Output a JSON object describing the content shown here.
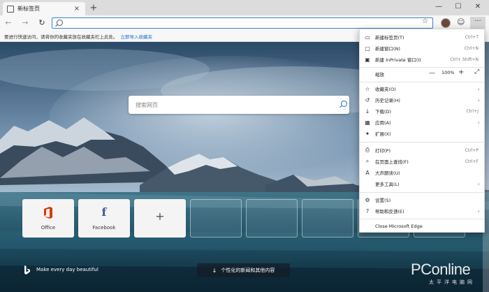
{
  "tab": {
    "title": "新标签页",
    "close": "×",
    "new_tab": "+"
  },
  "window": {
    "minimize": "—",
    "maximize": "☐",
    "close": "✕"
  },
  "toolbar": {
    "back": "←",
    "forward": "→",
    "refresh": "↻",
    "favorite": "☆",
    "emoji": "☺",
    "more": "···"
  },
  "address": {
    "value": "",
    "placeholder": ""
  },
  "favbar": {
    "message": "要进行快速访问，请将你的收藏夹放在收藏夹栏上此处。",
    "link": "立即导入收藏夹"
  },
  "search": {
    "placeholder": "搜索网页"
  },
  "tiles": [
    {
      "label": "Office",
      "icon": "office-icon"
    },
    {
      "label": "Facebook",
      "icon": "facebook-icon"
    },
    {
      "label": "",
      "icon": "plus-icon"
    }
  ],
  "footer": {
    "tagline": "Make every day beautiful",
    "news_button": "个性化的新闻和其他内容",
    "news_arrow": "↓"
  },
  "watermark": {
    "brand": "PConline",
    "sub": "太平洋电脑网"
  },
  "menu": {
    "items": [
      {
        "icon": "new-tab-icon",
        "glyph": "▭",
        "label": "新建标签页(T)",
        "shortcut": "Ctrl+T"
      },
      {
        "icon": "new-window-icon",
        "glyph": "▢",
        "label": "新建窗口(N)",
        "shortcut": "Ctrl+N"
      },
      {
        "icon": "inprivate-icon",
        "glyph": "▣",
        "label": "新建 InPrivate 窗口(I)",
        "shortcut": "Ctrl+  Shift+N"
      },
      {
        "icon": "favorites-icon",
        "glyph": "☆",
        "label": "收藏夹(O)",
        "shortcut": ""
      },
      {
        "icon": "history-icon",
        "glyph": "↺",
        "label": "历史记录(H)",
        "shortcut": ""
      },
      {
        "icon": "download-icon",
        "glyph": "↓",
        "label": "下载(D)",
        "shortcut": "Ctrl+J"
      },
      {
        "icon": "apps-icon",
        "glyph": "▦",
        "label": "应用(A)",
        "shortcut": ""
      },
      {
        "icon": "extensions-icon",
        "glyph": "✦",
        "label": "扩展(X)",
        "shortcut": ""
      },
      {
        "icon": "print-icon",
        "glyph": "⎙",
        "label": "打印(P)",
        "shortcut": "Ctrl+P"
      },
      {
        "icon": "find-icon",
        "glyph": "⌕",
        "label": "在页面上查找(F)",
        "shortcut": "Ctrl+F"
      },
      {
        "icon": "read-aloud-icon",
        "glyph": "A",
        "label": "大声朗读(U)",
        "shortcut": ""
      },
      {
        "icon": "more-tools-icon",
        "glyph": "",
        "label": "更多工具(L)",
        "shortcut": ""
      },
      {
        "icon": "settings-icon",
        "glyph": "⚙",
        "label": "设置(S)",
        "shortcut": ""
      },
      {
        "icon": "help-icon",
        "glyph": "?",
        "label": "帮助和反馈(E)",
        "shortcut": ""
      },
      {
        "icon": "",
        "glyph": "",
        "label": "Close Microsoft Edge",
        "shortcut": ""
      }
    ],
    "zoom": {
      "label": "缩放",
      "minus": "—",
      "value": "100%",
      "plus": "+",
      "fullscreen": "⤢"
    },
    "chevron": "›"
  },
  "colors": {
    "accent": "#1a6dd0",
    "office": "#d83b01",
    "facebook": "#3b5998"
  }
}
